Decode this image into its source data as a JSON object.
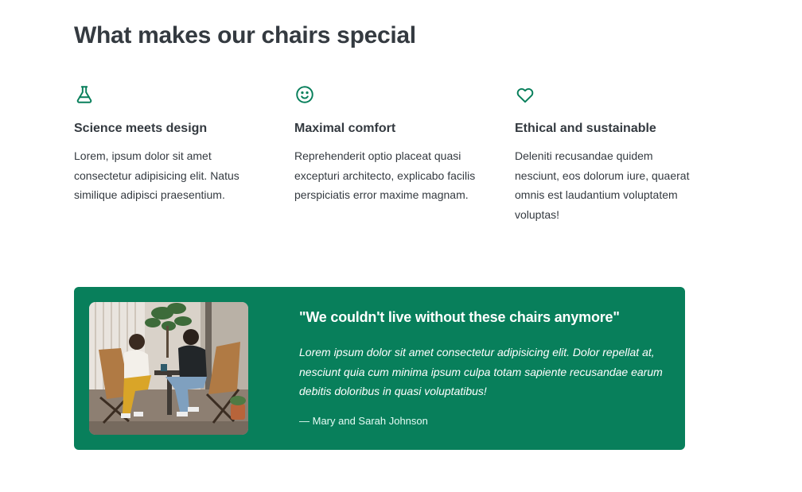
{
  "section": {
    "title": "What makes our chairs special"
  },
  "features": [
    {
      "icon": "flask-icon",
      "title": "Science meets design",
      "text": "Lorem, ipsum dolor sit amet consectetur adipisicing elit. Natus similique adipisci praesentium."
    },
    {
      "icon": "smiley-icon",
      "title": "Maximal comfort",
      "text": "Reprehenderit optio placeat quasi excepturi architecto, explicabo facilis perspiciatis error maxime magnam."
    },
    {
      "icon": "heart-icon",
      "title": "Ethical and sustainable",
      "text": "Deleniti recusandae quidem nesciunt, eos dolorum iure, quaerat omnis est laudantium voluptatem voluptas!"
    }
  ],
  "testimonial": {
    "image": "photo of two women sitting on leather chairs",
    "quote": "\"We couldn't live without these chairs anymore\"",
    "text": "Lorem ipsum dolor sit amet consectetur adipisicing elit. Dolor repellat at, nesciunt quia cum minima ipsum culpa totam sapiente recusandae earum debitis doloribus in quasi voluptatibus!",
    "author": "— Mary and Sarah Johnson"
  },
  "colors": {
    "accent": "#087f5b",
    "text": "#343a40",
    "background": "#ffffff"
  }
}
